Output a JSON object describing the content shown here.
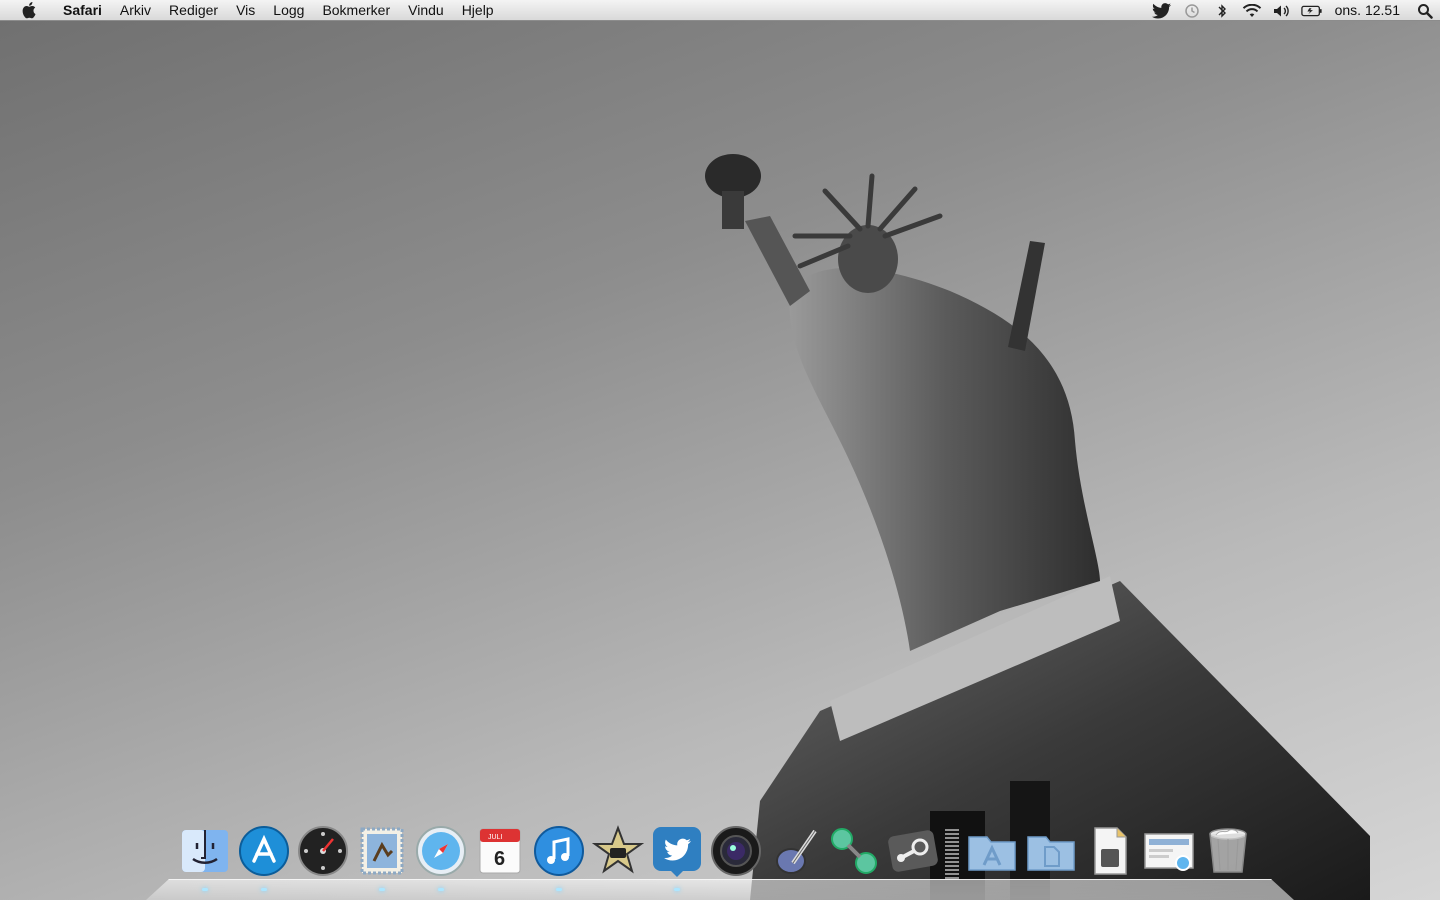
{
  "menubar": {
    "apple_icon": "apple-logo-icon",
    "app_name": "Safari",
    "items": [
      "Arkiv",
      "Rediger",
      "Vis",
      "Logg",
      "Bokmerker",
      "Vindu",
      "Hjelp"
    ],
    "status_icons": [
      "twitter-bird-icon",
      "time-machine-icon",
      "bluetooth-icon",
      "wifi-icon",
      "volume-icon",
      "battery-icon"
    ],
    "clock": "ons. 12.51",
    "spotlight_icon": "spotlight-search-icon"
  },
  "wallpaper": {
    "subject": "statue-of-liberty-icon"
  },
  "dock": {
    "apps": [
      {
        "name": "Finder",
        "icon": "finder-icon",
        "running": true
      },
      {
        "name": "App Store",
        "icon": "app-store-icon",
        "running": true
      },
      {
        "name": "Dashboard",
        "icon": "dashboard-icon",
        "running": false
      },
      {
        "name": "Mail",
        "icon": "mail-icon",
        "running": true
      },
      {
        "name": "Safari",
        "icon": "safari-icon",
        "running": true
      },
      {
        "name": "iCal",
        "icon": "calendar-icon",
        "running": false,
        "month": "JULI",
        "day": "6"
      },
      {
        "name": "iTunes",
        "icon": "itunes-icon",
        "running": true
      },
      {
        "name": "iMovie",
        "icon": "imovie-icon",
        "running": false
      },
      {
        "name": "Twitter",
        "icon": "twitter-icon",
        "running": true
      },
      {
        "name": "Aperture",
        "icon": "aperture-icon",
        "running": false
      },
      {
        "name": "Script Editor",
        "icon": "quill-icon",
        "running": false
      },
      {
        "name": "Network Utility",
        "icon": "network-utility-icon",
        "running": false
      },
      {
        "name": "Steam",
        "icon": "steam-icon",
        "running": false
      }
    ],
    "stacks": [
      {
        "name": "Programmer",
        "icon": "applications-folder-icon"
      },
      {
        "name": "Dokumenter",
        "icon": "documents-folder-icon"
      },
      {
        "name": "Notat",
        "icon": "document-icon"
      },
      {
        "name": "Web",
        "icon": "web-preview-icon"
      },
      {
        "name": "Papirkurv",
        "icon": "trash-icon"
      }
    ],
    "accent": "#1e8fd8"
  }
}
